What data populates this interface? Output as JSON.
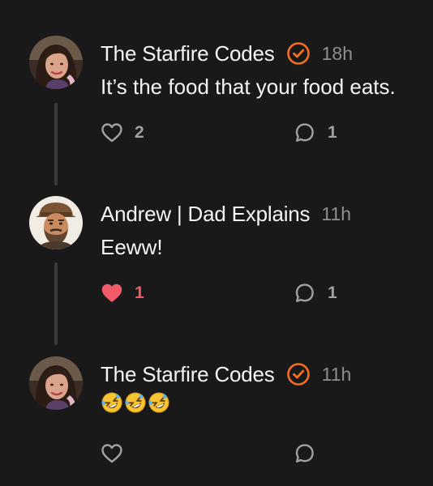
{
  "colors": {
    "background": "#19191a",
    "verified_badge": "#f36e23",
    "liked_heart": "#f45b69",
    "muted_text": "#8e8e93",
    "icon_stroke": "#a0a0a5"
  },
  "posts": [
    {
      "author": "The Starfire Codes",
      "verified": true,
      "time": "18h",
      "text": "It’s the food that your food eats.",
      "likes": "2",
      "liked": false,
      "replies": "1"
    },
    {
      "author": "Andrew | Dad Explains",
      "verified": false,
      "time": "11h",
      "text": "Eeww!",
      "likes": "1",
      "liked": true,
      "replies": "1"
    },
    {
      "author": "The Starfire Codes",
      "verified": true,
      "time": "11h",
      "text": "",
      "emoji": "rolling-on-the-floor-laughing x3",
      "likes": "",
      "liked": false,
      "replies": ""
    }
  ],
  "icons": {
    "like": "heart-icon",
    "liked": "heart-filled-icon",
    "reply": "comment-bubble-icon",
    "verified": "verified-check-icon"
  }
}
